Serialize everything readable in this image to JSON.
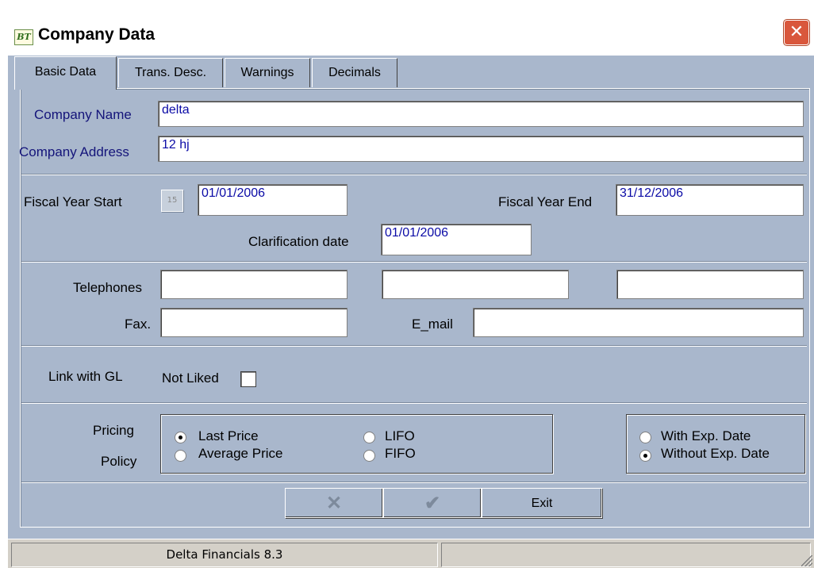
{
  "window": {
    "icon_text": "BT",
    "title": "Company Data",
    "close_glyph": "✕"
  },
  "tabs": [
    {
      "label": "Basic Data",
      "active": true
    },
    {
      "label": "Trans. Desc.",
      "active": false
    },
    {
      "label": "Warnings",
      "active": false
    },
    {
      "label": "Decimals",
      "active": false
    }
  ],
  "company": {
    "name_label": "Company Name",
    "name_value": "delta",
    "address_label": "Company Address",
    "address_value": "12 hj"
  },
  "fiscal": {
    "start_label": "Fiscal Year Start",
    "calendar_glyph": "15",
    "start_value": "01/01/2006",
    "end_label": "Fiscal Year End",
    "end_value": "31/12/2006",
    "clarification_label": "Clarification date",
    "clarification_value": "01/01/2006"
  },
  "contact": {
    "telephones_label": "Telephones",
    "telephone_values": [
      "",
      "",
      ""
    ],
    "fax_label": "Fax.",
    "fax_value": "",
    "email_label": "E_mail",
    "email_value": ""
  },
  "gl": {
    "label": "Link with GL",
    "checkbox_label": "Not Liked",
    "checked": false
  },
  "pricing": {
    "label_line1": "Pricing",
    "label_line2": "Policy",
    "options": [
      {
        "label": "Last Price",
        "checked": true
      },
      {
        "label": "Average Price",
        "checked": false
      },
      {
        "label": "LIFO",
        "checked": false
      },
      {
        "label": "FIFO",
        "checked": false
      }
    ]
  },
  "expiry": {
    "options": [
      {
        "label": "With Exp. Date",
        "checked": false
      },
      {
        "label": "Without Exp. Date",
        "checked": true
      }
    ]
  },
  "buttons": {
    "cancel_glyph": "✕",
    "ok_glyph": "✔",
    "exit_label": "Exit"
  },
  "statusbar": {
    "app_version": "Delta Financials 8.3",
    "right_text": ""
  },
  "colors": {
    "panel_bg": "#a9b7cc",
    "field_text": "#0a0aa6",
    "label_blue": "#14147a",
    "close_red": "#d9573c"
  }
}
